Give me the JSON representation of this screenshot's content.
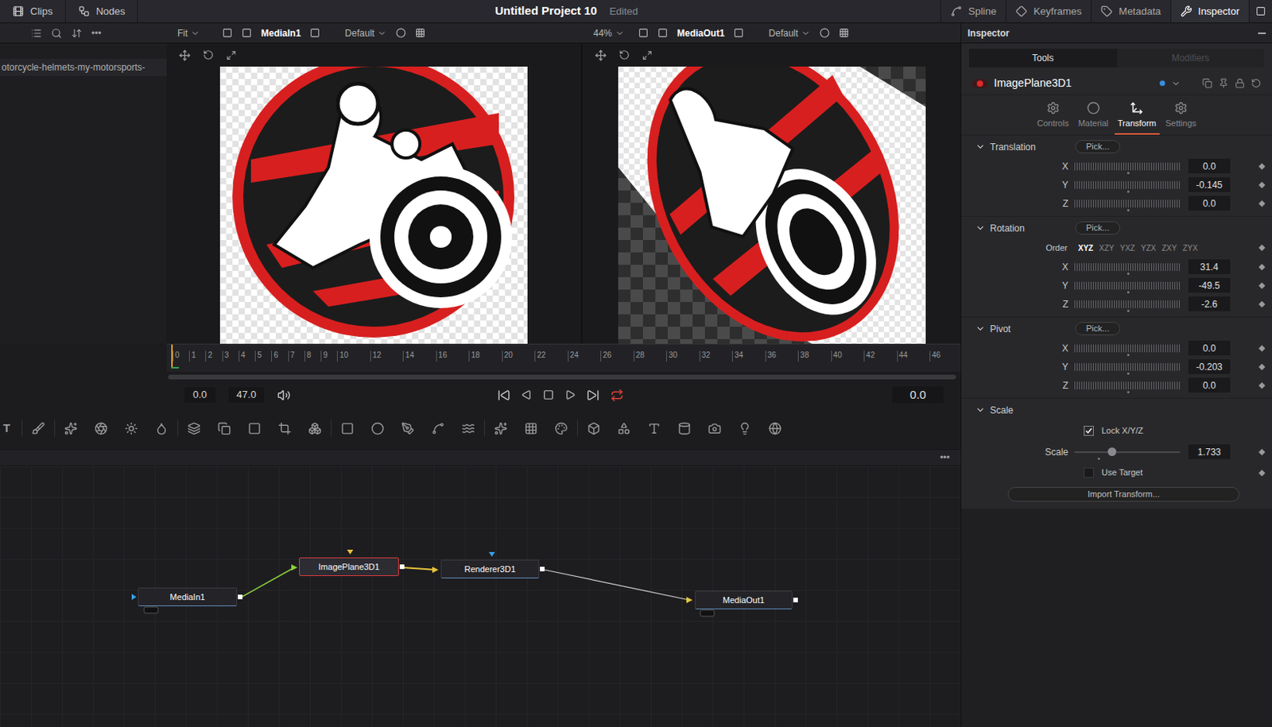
{
  "topbar": {
    "tabs": [
      {
        "label": "Clips",
        "selected": false
      },
      {
        "label": "Nodes",
        "selected": false
      }
    ],
    "title": "Untitled Project 10",
    "status": "Edited",
    "panels": [
      {
        "label": "Spline",
        "selected": false
      },
      {
        "label": "Keyframes",
        "selected": false
      },
      {
        "label": "Metadata",
        "selected": false
      },
      {
        "label": "Inspector",
        "selected": true
      }
    ]
  },
  "viewer_toolbar": {
    "more": "•••",
    "left": {
      "zoom": "Fit",
      "source": "MediaIn1",
      "lut": "Default"
    },
    "right": {
      "zoom": "44%",
      "source": "MediaOut1",
      "lut": "Default"
    }
  },
  "media_pool": {
    "items": [
      {
        "label": "otorcycle-helmets-my-motorsports-",
        "selected": true
      }
    ]
  },
  "timeline": {
    "ticks": [
      "0",
      "1",
      "2",
      "3",
      "4",
      "5",
      "6",
      "7",
      "8",
      "9",
      "10",
      "12",
      "14",
      "16",
      "18",
      "20",
      "22",
      "24",
      "26",
      "28",
      "30",
      "32",
      "34",
      "36",
      "38",
      "40",
      "42",
      "44",
      "46"
    ],
    "start": "0.0",
    "end": "47.0",
    "current": "0.0",
    "loop": true
  },
  "toolbar": {
    "leading": "T"
  },
  "node_editor": {
    "more": "•••",
    "nodes": [
      {
        "label": "MediaIn1",
        "selected": false
      },
      {
        "label": "ImagePlane3D1",
        "selected": true
      },
      {
        "label": "Renderer3D1",
        "selected": false
      },
      {
        "label": "MediaOut1",
        "selected": false
      }
    ]
  },
  "inspector": {
    "title": "Inspector",
    "tabs": [
      {
        "label": "Tools",
        "selected": true
      },
      {
        "label": "Modifiers",
        "selected": false
      }
    ],
    "tool": "ImagePlane3D1",
    "subtabs": [
      {
        "label": "Controls",
        "selected": false
      },
      {
        "label": "Material",
        "selected": false
      },
      {
        "label": "Transform",
        "selected": true
      },
      {
        "label": "Settings",
        "selected": false
      }
    ],
    "sections": [
      {
        "title": "Translation",
        "expanded": true,
        "pick": "Pick...",
        "rows": [
          {
            "kind": "slider",
            "label": "X",
            "value": "0.0",
            "level": 0.5
          },
          {
            "kind": "slider",
            "label": "Y",
            "value": "-0.145",
            "level": 0.5
          },
          {
            "kind": "slider",
            "label": "Z",
            "value": "0.0",
            "level": 0.5
          }
        ]
      },
      {
        "title": "Rotation",
        "expanded": true,
        "pick": "Pick...",
        "rows": [
          {
            "kind": "order",
            "label": "Order",
            "options": [
              {
                "label": "XYZ",
                "selected": true
              },
              {
                "label": "XZY",
                "selected": false
              },
              {
                "label": "YXZ",
                "selected": false
              },
              {
                "label": "YZX",
                "selected": false
              },
              {
                "label": "ZXY",
                "selected": false
              },
              {
                "label": "ZYX",
                "selected": false
              }
            ]
          },
          {
            "kind": "slider",
            "label": "X",
            "value": "31.4",
            "level": 0.5
          },
          {
            "kind": "slider",
            "label": "Y",
            "value": "-49.5",
            "level": 0.5
          },
          {
            "kind": "slider",
            "label": "Z",
            "value": "-2.6",
            "level": 0.5
          }
        ]
      },
      {
        "title": "Pivot",
        "expanded": true,
        "pick": "Pick...",
        "rows": [
          {
            "kind": "slider",
            "label": "X",
            "value": "0.0",
            "level": 0.5
          },
          {
            "kind": "slider",
            "label": "Y",
            "value": "-0.203",
            "level": 0.5
          },
          {
            "kind": "slider",
            "label": "Z",
            "value": "0.0",
            "level": 0.5
          }
        ]
      },
      {
        "title": "Scale",
        "expanded": true,
        "pick": "",
        "rows": [
          {
            "kind": "checkbox",
            "label": "Lock X/Y/Z",
            "checked": true
          },
          {
            "kind": "range",
            "label": "Scale",
            "value": "1.733",
            "level": 0.35
          },
          {
            "kind": "checkbox",
            "label": "Use Target",
            "checked": false
          },
          {
            "kind": "button",
            "label": "Import Transform..."
          }
        ]
      }
    ]
  }
}
